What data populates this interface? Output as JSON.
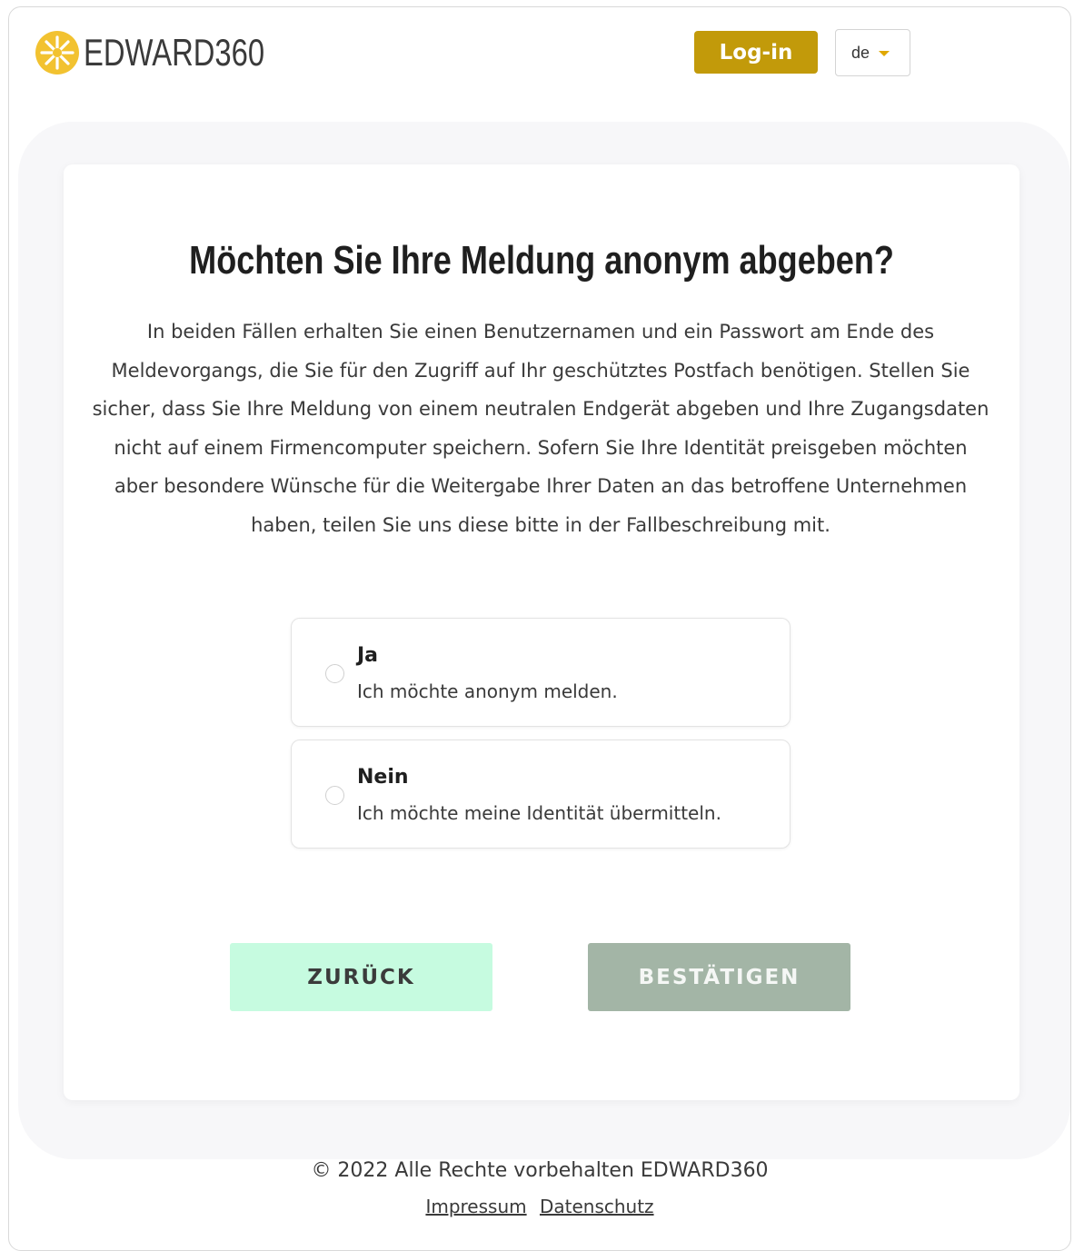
{
  "header": {
    "brand": "EDWARD360",
    "login_label": "Log-in",
    "language": "de",
    "brand_color": "#c29a0a"
  },
  "main": {
    "title": "Möchten Sie Ihre Meldung anonym abgeben?",
    "description": "In beiden Fällen erhalten Sie einen Benutzernamen und ein Passwort am Ende des Meldevorgangs, die Sie für den Zugriff auf Ihr geschütztes Postfach benötigen. Stellen Sie sicher, dass Sie Ihre Meldung von einem neutralen Endgerät abgeben und Ihre Zugangsdaten nicht auf einem Firmencomputer speichern. Sofern Sie Ihre Identität preisgeben möchten aber besondere Wünsche für die Weitergabe Ihrer Daten an das betroffene Unternehmen haben, teilen Sie uns diese bitte in der Fallbeschreibung mit.",
    "options": [
      {
        "title": "Ja",
        "subtitle": "Ich möchte anonym melden."
      },
      {
        "title": "Nein",
        "subtitle": "Ich möchte meine Identität übermitteln."
      }
    ],
    "back_label": "ZURÜCK",
    "confirm_label": "BESTÄTIGEN",
    "back_color": "#c6fbe0",
    "confirm_color": "#a3b5a6"
  },
  "footer": {
    "copyright": "© 2022 Alle Rechte vorbehalten EDWARD360",
    "links": [
      "Impressum",
      "Datenschutz"
    ]
  }
}
